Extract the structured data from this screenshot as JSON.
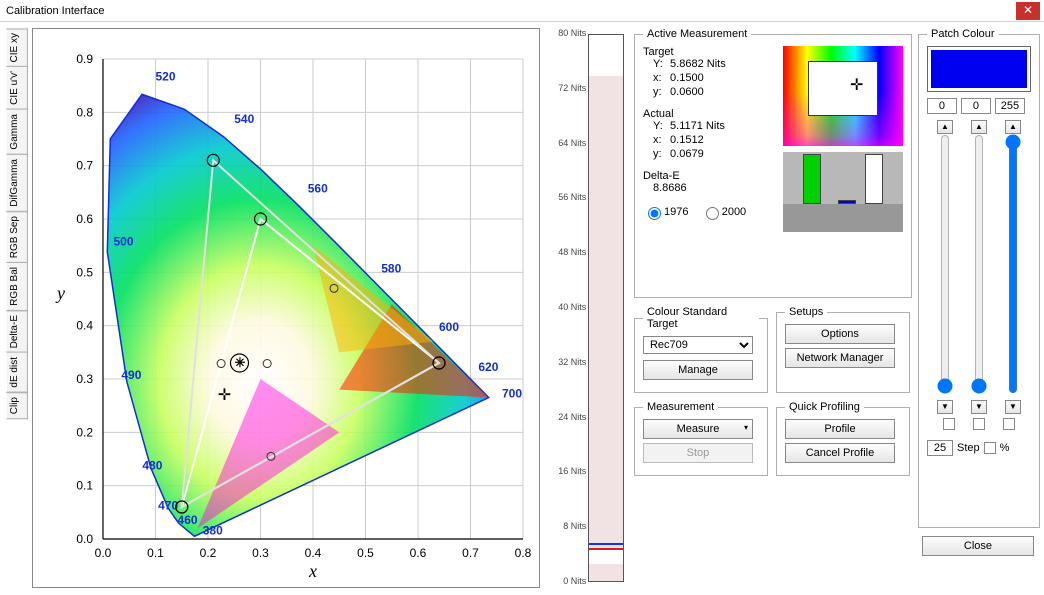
{
  "window": {
    "title": "Calibration Interface"
  },
  "tabs": [
    "CIE xy",
    "CIE u'v'",
    "Gamma",
    "DifGamma",
    "RGB Sep",
    "RGB Bal",
    "Delta-E",
    "dE dist",
    "Clip"
  ],
  "chart_data": {
    "type": "scatter",
    "title": "",
    "xlabel": "x",
    "ylabel": "y",
    "xlim": [
      0.0,
      0.8
    ],
    "ylim": [
      0.0,
      0.9
    ],
    "xticks": [
      0.0,
      0.1,
      0.2,
      0.3,
      0.4,
      0.5,
      0.6,
      0.7,
      0.8
    ],
    "yticks": [
      0.0,
      0.1,
      0.2,
      0.3,
      0.4,
      0.5,
      0.6,
      0.7,
      0.8,
      0.9
    ],
    "wavelength_labels": [
      380,
      460,
      470,
      480,
      490,
      500,
      520,
      540,
      560,
      580,
      600,
      620,
      700
    ],
    "gamut_triangle": [
      {
        "x": 0.64,
        "y": 0.33
      },
      {
        "x": 0.3,
        "y": 0.6
      },
      {
        "x": 0.15,
        "y": 0.06
      }
    ],
    "secondary_gamut": [
      {
        "x": 0.64,
        "y": 0.33
      },
      {
        "x": 0.21,
        "y": 0.71
      },
      {
        "x": 0.15,
        "y": 0.06
      }
    ],
    "extra_points": [
      {
        "x": 0.3127,
        "y": 0.329
      },
      {
        "x": 0.225,
        "y": 0.329
      },
      {
        "x": 0.44,
        "y": 0.47
      },
      {
        "x": 0.32,
        "y": 0.155
      }
    ],
    "target_marker": {
      "x": 0.23,
      "y": 0.27
    },
    "actual_marker": {
      "x": 0.26,
      "y": 0.33
    }
  },
  "nits": {
    "ticks": [
      0,
      8,
      16,
      24,
      32,
      40,
      48,
      56,
      64,
      72,
      80
    ],
    "unit": "Nits",
    "target": 5.8682,
    "actual": 5.1171,
    "max": 80
  },
  "active_measurement": {
    "legend": "Active Measurement",
    "target_label": "Target",
    "target": {
      "Y": "5.8682 Nits",
      "x": "0.1500",
      "y": "0.0600"
    },
    "actual_label": "Actual",
    "actual": {
      "Y": "5.1171 Nits",
      "x": "0.1512",
      "y": "0.0679"
    },
    "deltae_label": "Delta-E",
    "deltae": "8.8686",
    "radios": {
      "r1976": "1976",
      "r2000": "2000",
      "selected": "1976"
    }
  },
  "colour_standard": {
    "legend": "Colour Standard Target",
    "selected": "Rec709",
    "manage": "Manage"
  },
  "setups": {
    "legend": "Setups",
    "options": "Options",
    "network": "Network Manager"
  },
  "measurement": {
    "legend": "Measurement",
    "measure": "Measure",
    "stop": "Stop"
  },
  "quick": {
    "legend": "Quick Profiling",
    "profile": "Profile",
    "cancel": "Cancel Profile"
  },
  "patch": {
    "legend": "Patch Colour",
    "r": "0",
    "g": "0",
    "b": "255",
    "step_value": "25",
    "step_label": "Step",
    "percent_label": "%"
  },
  "close_label": "Close"
}
